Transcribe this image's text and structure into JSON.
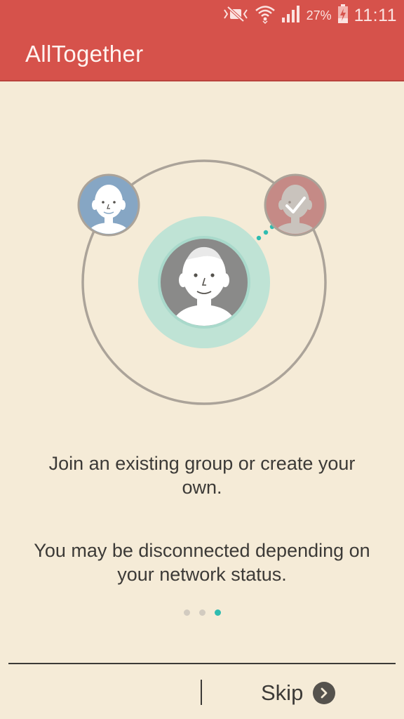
{
  "status_bar": {
    "icons": [
      "mute-vibrate-icon",
      "wifi-icon",
      "signal-icon",
      "battery-charging-icon"
    ],
    "battery": "27%",
    "time": "11:11"
  },
  "app": {
    "title": "AllTogether",
    "header_color": "#d6524b",
    "accent_color": "#2fbcb0"
  },
  "onboarding": {
    "text_primary": "Join an existing group or create your own.",
    "text_secondary": "You may be disconnected depending on your network status.",
    "pages": 3,
    "current_page": 3
  },
  "footer": {
    "skip_label": "Skip",
    "skip_icon": "chevron-right-icon"
  }
}
